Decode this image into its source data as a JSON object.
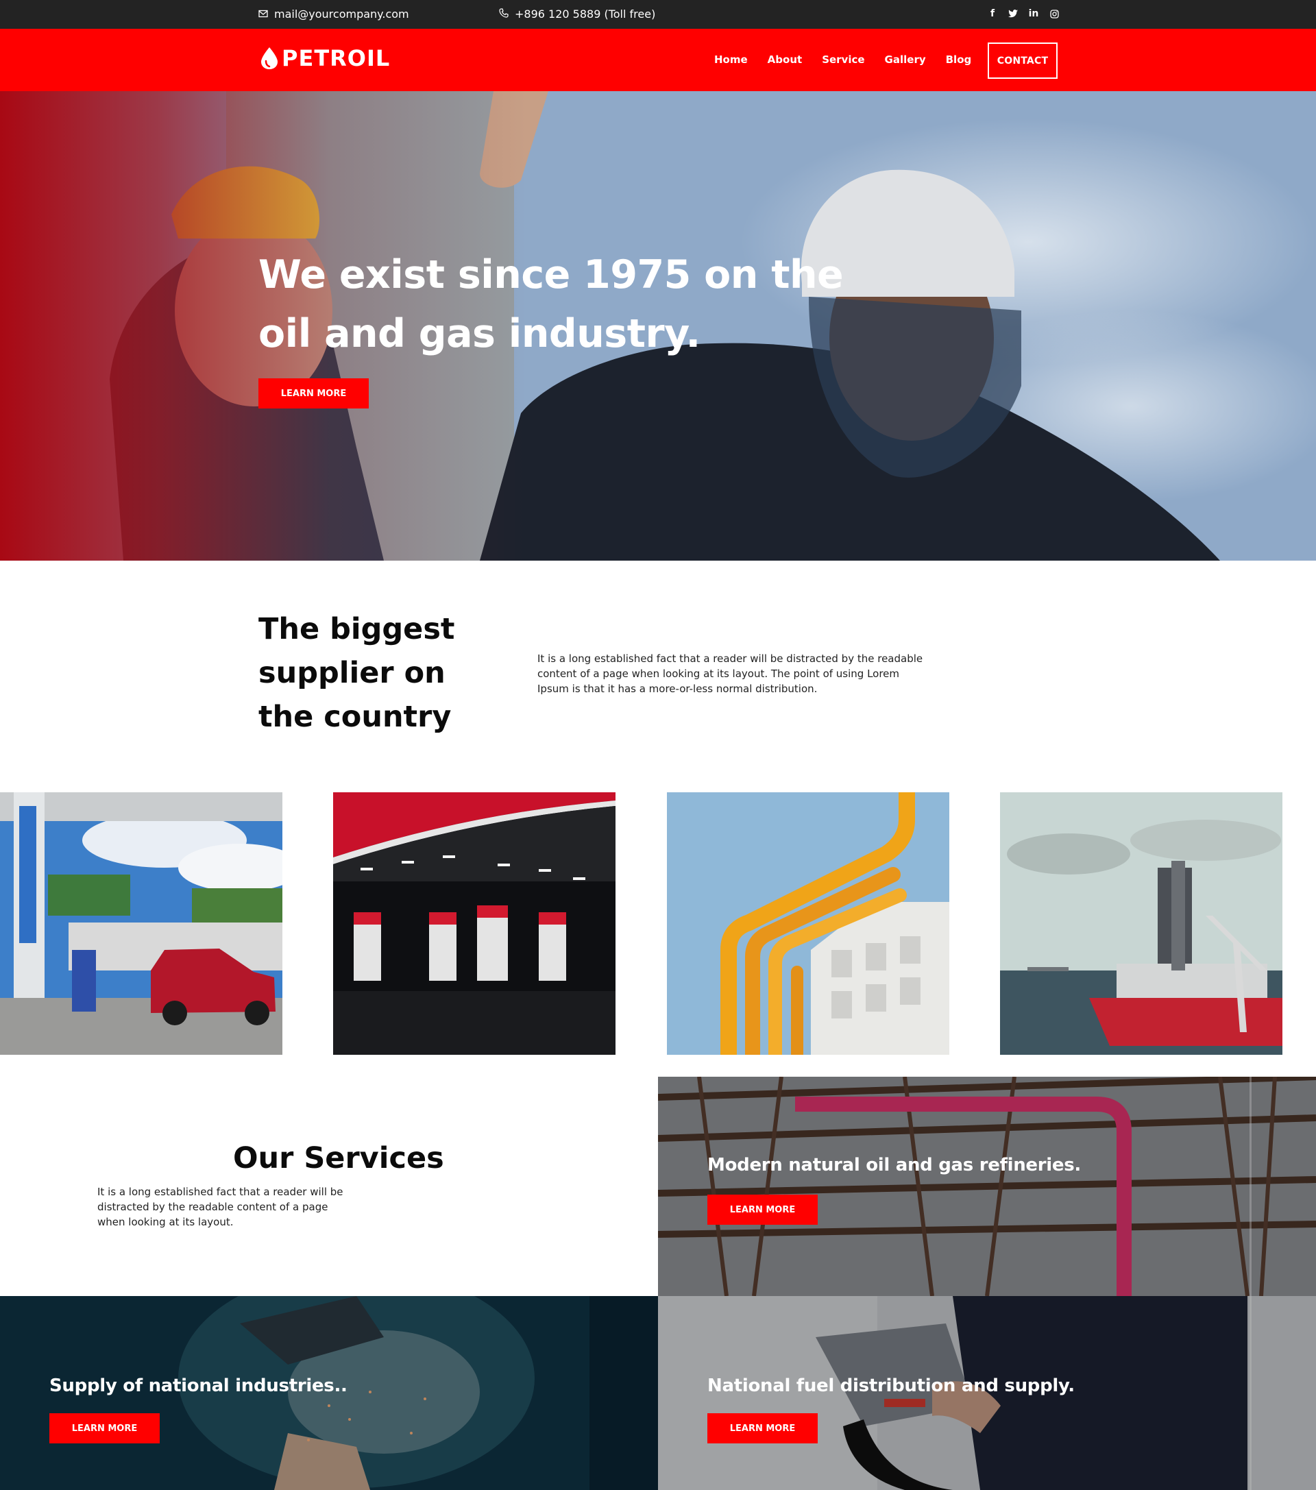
{
  "topbar": {
    "email": "mail@yourcompany.com",
    "phone": "+896 120 5889 (Toll free)",
    "socials": [
      "facebook-icon",
      "twitter-icon",
      "linkedin-icon",
      "instagram-icon"
    ]
  },
  "brand": {
    "name": "PETROIL",
    "color": "#ff0000"
  },
  "nav": {
    "items": [
      "Home",
      "About",
      "Service",
      "Gallery",
      "Blog"
    ],
    "contact": "CONTACT"
  },
  "hero": {
    "title": "We exist since 1975 on the oil and gas industry.",
    "button": "LEARN MORE"
  },
  "intro": {
    "title": "The biggest supplier on the country",
    "text": "It is a long established fact that a reader will be distracted by the readable content of a page when looking at its layout. The point of using Lorem Ipsum is that it has a more-or-less normal distribution."
  },
  "services": {
    "title": "Our Services",
    "text": "It is a long established fact that a reader will be distracted by the readable content of a page when looking at its layout.",
    "cards": [
      {
        "title": "Modern natural oil and gas refineries.",
        "button": "LEARN MORE"
      },
      {
        "title": "Supply of national industries..",
        "button": "LEARN MORE"
      },
      {
        "title": "National fuel distribution and supply.",
        "button": "LEARN MORE"
      }
    ]
  }
}
